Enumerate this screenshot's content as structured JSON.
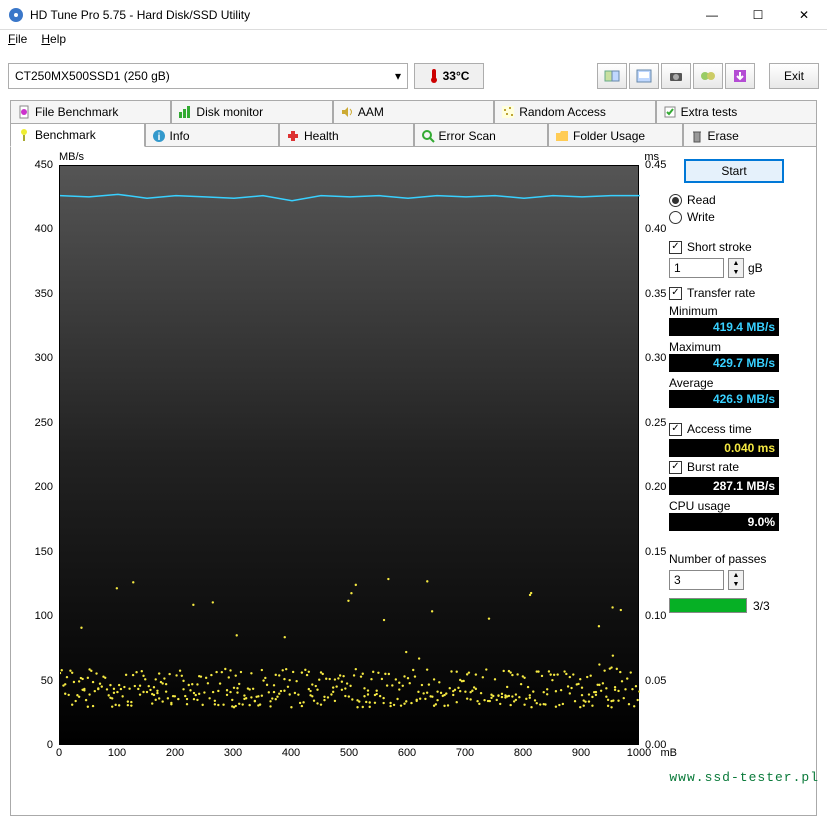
{
  "window": {
    "title": "HD Tune Pro 5.75 - Hard Disk/SSD Utility"
  },
  "menu": {
    "file": "File",
    "help": "Help"
  },
  "toolbar": {
    "drive": "CT250MX500SSD1 (250 gB)",
    "temp": "33°C",
    "exit": "Exit"
  },
  "tabs_row1": [
    "File Benchmark",
    "Disk monitor",
    "AAM",
    "Random Access",
    "Extra tests"
  ],
  "tabs_row2": [
    "Benchmark",
    "Info",
    "Health",
    "Error Scan",
    "Folder Usage",
    "Erase"
  ],
  "side": {
    "start": "Start",
    "read": "Read",
    "write": "Write",
    "short_stroke": "Short stroke",
    "short_stroke_val": "1",
    "short_stroke_unit": "gB",
    "transfer_rate": "Transfer rate",
    "minimum_label": "Minimum",
    "minimum_val": "419.4 MB/s",
    "maximum_label": "Maximum",
    "maximum_val": "429.7 MB/s",
    "average_label": "Average",
    "average_val": "426.9 MB/s",
    "access_label": "Access time",
    "access_val": "0.040 ms",
    "burst_label": "Burst rate",
    "burst_val": "287.1 MB/s",
    "cpu_label": "CPU usage",
    "cpu_val": "9.0%",
    "passes_label": "Number of passes",
    "passes_val": "3",
    "passes_text": "3/3"
  },
  "chart_data": {
    "type": "line+scatter",
    "title": "",
    "y_left_label": "MB/s",
    "y_right_label": "ms",
    "x_unit": "mB",
    "x_ticks": [
      0,
      100,
      200,
      300,
      400,
      500,
      600,
      700,
      800,
      900,
      1000
    ],
    "y_left_ticks": [
      0,
      50,
      100,
      150,
      200,
      250,
      300,
      350,
      400,
      450
    ],
    "y_left_range": [
      0,
      450
    ],
    "y_right_ticks": [
      0,
      0.05,
      0.1,
      0.15,
      0.2,
      0.25,
      0.3,
      0.35,
      0.4,
      0.45
    ],
    "y_right_range": [
      0,
      0.45
    ],
    "series": [
      {
        "name": "Transfer rate (MB/s)",
        "axis": "left",
        "color": "#38d0ff",
        "x": [
          0,
          50,
          100,
          150,
          200,
          250,
          300,
          350,
          400,
          450,
          500,
          550,
          600,
          650,
          700,
          750,
          800,
          850,
          900,
          950,
          1000
        ],
        "y": [
          427,
          426,
          428,
          425,
          427,
          426,
          425,
          427,
          423,
          427,
          426,
          427,
          425,
          427,
          426,
          427,
          425,
          427,
          426,
          427,
          427
        ]
      },
      {
        "name": "Access time (ms)",
        "axis": "right",
        "color": "#f5e942",
        "type": "scatter",
        "approx_mean": 0.04,
        "approx_range": [
          0.03,
          0.06
        ],
        "outliers_approx": [
          0.08,
          0.09,
          0.1,
          0.13
        ]
      }
    ]
  },
  "watermark": "www.ssd-tester.pl"
}
